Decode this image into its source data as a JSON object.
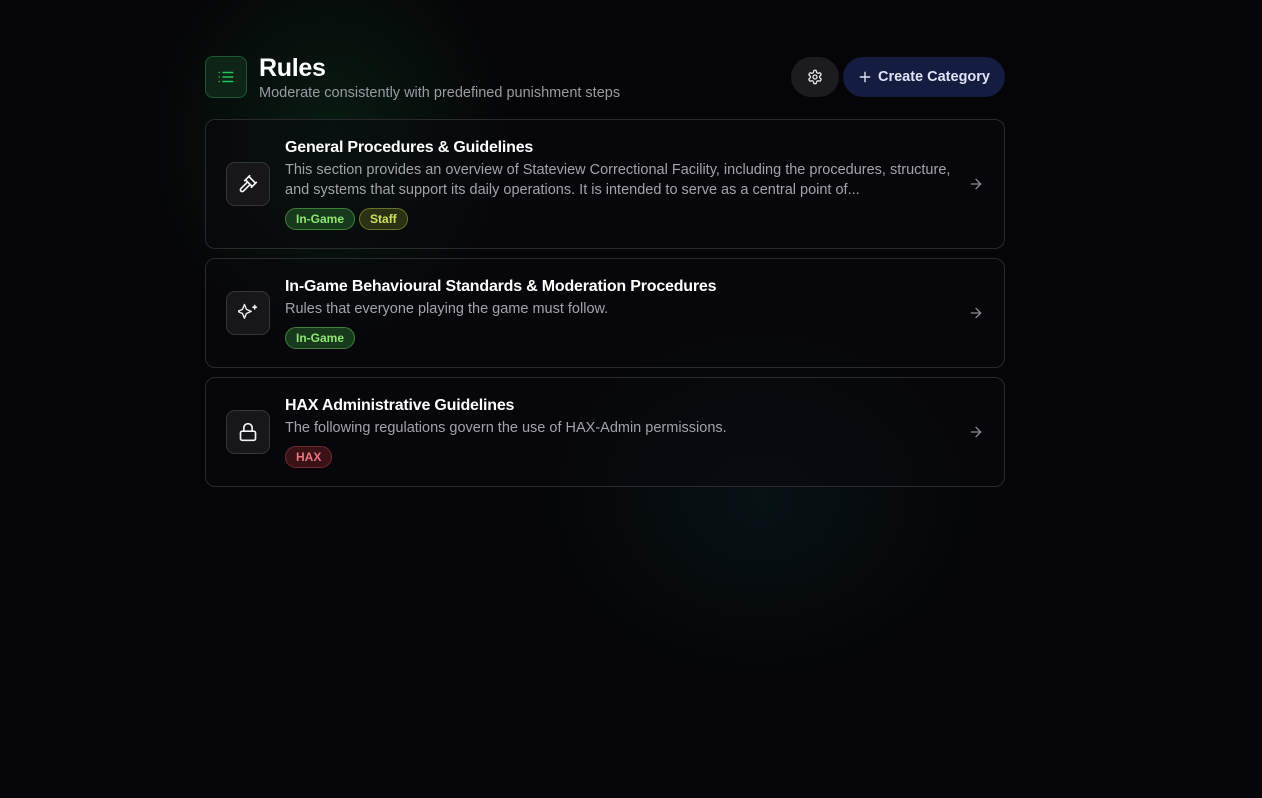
{
  "header": {
    "title": "Rules",
    "subtitle": "Moderate consistently with predefined punishment steps",
    "icon": "list-icon",
    "settings_icon": "gear-icon",
    "create_label": "Create Category",
    "create_icon": "plus-icon"
  },
  "categories": [
    {
      "title": "General Procedures & Guidelines",
      "description": "This section provides an overview of Stateview Correctional Facility, including the procedures, structure, and systems that support its daily operations. It is intended to serve as a central point of...",
      "icon": "gavel-icon",
      "tags": [
        "In-Game",
        "Staff"
      ]
    },
    {
      "title": "In-Game Behavioural Standards & Moderation Procedures",
      "description": "Rules that everyone playing the game must follow.",
      "icon": "sparkles-icon",
      "tags": [
        "In-Game"
      ]
    },
    {
      "title": "HAX Administrative Guidelines",
      "description": "The following regulations govern the use of HAX-Admin permissions.",
      "icon": "lock-icon",
      "tags": [
        "HAX"
      ]
    }
  ],
  "colors": {
    "accent_green": "#22c55e",
    "tag_green": "#8fe673",
    "tag_olive": "#cfe05d",
    "tag_red": "#f0727c",
    "create_button_bg": "#141c3f"
  }
}
